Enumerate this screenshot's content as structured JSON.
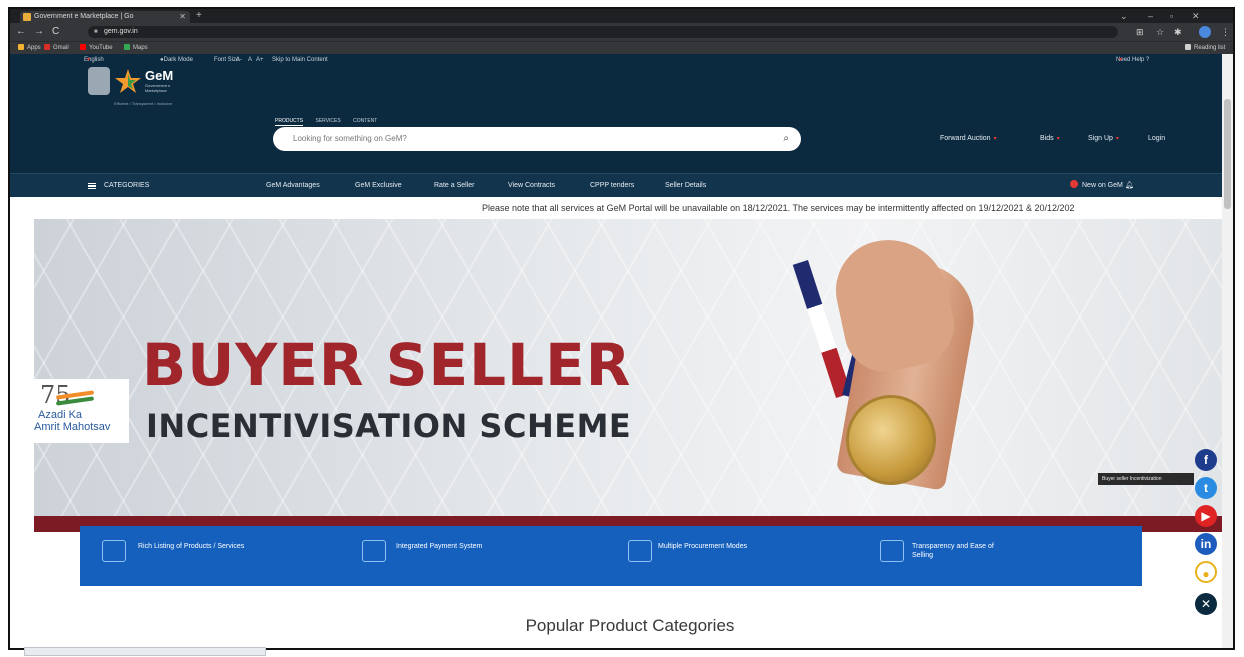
{
  "browser": {
    "tab_title": "Government e Marketplace | Go",
    "url": "gem.gov.in",
    "bookmarks": [
      "Apps",
      "Gmail",
      "YouTube",
      "Maps"
    ],
    "reading_list": "Reading list"
  },
  "topbar": {
    "language": "English",
    "dark_mode": "Dark Mode",
    "font_size_label": "Font Size",
    "font_sizes": [
      "A-",
      "A",
      "A+"
    ],
    "skip": "Skip to Main Content",
    "need_help": "Need Help ?"
  },
  "header": {
    "logo_text": "GeM",
    "logo_sub": "Government e Marketplace",
    "logo_tag": "Efficient • Transparent • Inclusive",
    "search_tabs": [
      "PRODUCTS",
      "SERVICES",
      "CONTENT"
    ],
    "search_placeholder": "Looking for something on GeM?",
    "links": [
      "Forward Auction",
      "Bids",
      "Sign Up",
      "Login"
    ]
  },
  "nav": {
    "categories": "CATEGORIES",
    "items": [
      "GeM Advantages",
      "GeM Exclusive",
      "Rate a Seller",
      "View Contracts",
      "CPPP tenders",
      "Seller Details"
    ],
    "new_on": "New on GeM"
  },
  "notice": "Please note that all services at GeM Portal will be unavailable on 18/12/2021. The services may be intermittently affected on 19/12/2021 & 20/12/202",
  "hero": {
    "title": "BUYER SELLER",
    "subtitle": "INCENTIVISATION SCHEME",
    "azadi_top": "75",
    "azadi_1": "Azadi Ka",
    "azadi_2": "Amrit Mahotsav",
    "slide_count": 6,
    "active_slide": 0
  },
  "features": [
    {
      "label": "Rich Listing of Products / Services",
      "icon": "cubes-icon"
    },
    {
      "label": "Integrated Payment System",
      "icon": "payment-icon"
    },
    {
      "label": "Multiple Procurement Modes",
      "icon": "gavel-icon"
    },
    {
      "label": "Transparency and Ease of Selling",
      "icon": "monitor-icon"
    }
  ],
  "section_title": "Popular Product Categories",
  "social": {
    "tooltip": "Buyer seller Incentivization",
    "icons": [
      "facebook-icon",
      "twitter-icon",
      "youtube-icon",
      "linkedin-icon",
      "koo-icon",
      "close-icon"
    ]
  },
  "colors": {
    "header_bg": "#0c2a3f",
    "hero_red": "#a0262c",
    "feature_blue": "#1560bd"
  }
}
